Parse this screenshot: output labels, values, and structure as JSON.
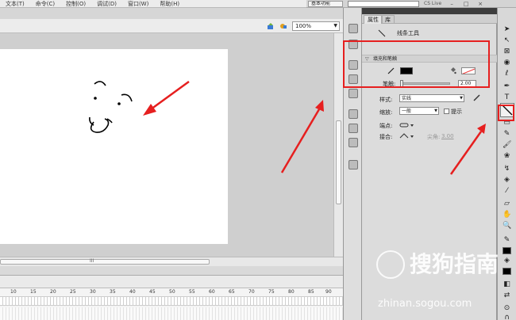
{
  "menu": {
    "items": [
      "文本(T)",
      "命令(C)",
      "控制(O)",
      "调试(D)",
      "窗口(W)",
      "帮助(H)"
    ]
  },
  "topbar": {
    "workspace_label": "基本功能",
    "cs_live": "CS Live"
  },
  "stage": {
    "zoom": "100%",
    "scroll_grip": "III"
  },
  "timeline": {
    "frame_numbers": [
      "10",
      "15",
      "20",
      "25",
      "30",
      "35",
      "40",
      "45",
      "50",
      "55",
      "60",
      "65",
      "70",
      "75",
      "80",
      "85",
      "90"
    ]
  },
  "properties": {
    "tabs": [
      "属性",
      "库"
    ],
    "tool_name": "线条工具",
    "section_title": "填充和笔触",
    "stroke_label": "笔触:",
    "stroke_value": "2.00",
    "style_label": "样式:",
    "style_value": "实线",
    "scale_label": "缩放:",
    "scale_value": "一般",
    "hint_label": "提示",
    "cap_label": "端点:",
    "join_label": "接合:",
    "miter_label": "尖角:",
    "miter_value": "3.00"
  },
  "watermark": {
    "text": "搜狗指南",
    "url": "zhinan.sogou.com"
  },
  "colors": {
    "annotation": "#e61f1f",
    "stroke_color": "#000000"
  }
}
